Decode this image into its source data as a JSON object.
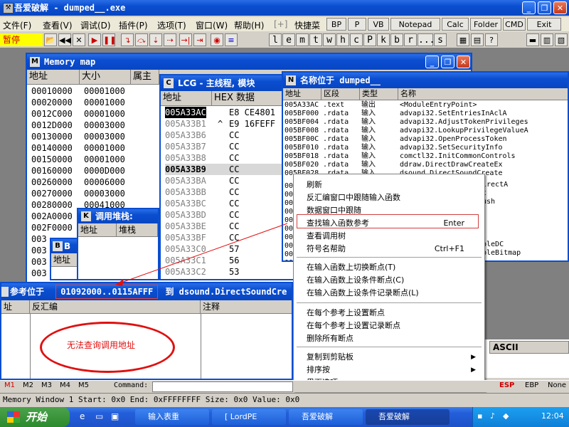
{
  "app": {
    "title": "吾爱破解 - dumped__.exe",
    "title_icon": "tools-icon"
  },
  "menubar": [
    "文件(F)",
    "查看(V)",
    "调试(D)",
    "插件(P)",
    "选项(T)",
    "窗口(W)",
    "帮助(H)",
    "[+]",
    "快捷菜",
    "BP",
    "P",
    "VB",
    "Notepad",
    "Calc",
    "Folder",
    "CMD",
    "Exit"
  ],
  "toolbar": {
    "status": "暂停",
    "letters": [
      "l",
      "e",
      "m",
      "t",
      "w",
      "h",
      "c",
      "P",
      "k",
      "b",
      "r",
      "...",
      "s"
    ]
  },
  "memory_map": {
    "title": "Memory map",
    "headers": [
      "地址",
      "大小",
      "属主"
    ],
    "addresses": [
      "00010000",
      "00020000",
      "0012C000",
      "0012D000",
      "00130000",
      "00140000",
      "00150000",
      "00160000",
      "00260000",
      "00270000",
      "00280000",
      "002A0000",
      "002F0000",
      "003",
      "003",
      "003",
      "003"
    ],
    "sizes": [
      "00001000",
      "00001000",
      "00001000",
      "00003000",
      "00003000",
      "00001000",
      "00001000",
      "0000D000",
      "00006000",
      "00003000",
      "00041000"
    ]
  },
  "lcg_window": {
    "title": "LCG - 主线程, 模块",
    "headers": [
      "地址",
      "HEX 数据"
    ],
    "rows": [
      {
        "addr": "005A33AC",
        "arrow": "",
        "hex": "E8 CE4801"
      },
      {
        "addr": "005A33B1",
        "arrow": "^",
        "hex": "E9 16FEFF"
      },
      {
        "addr": "005A33B6",
        "arrow": "",
        "hex": "CC"
      },
      {
        "addr": "005A33B7",
        "arrow": "",
        "hex": "CC"
      },
      {
        "addr": "005A33B8",
        "arrow": "",
        "hex": "CC"
      },
      {
        "addr": "005A33B9",
        "arrow": "",
        "hex": "CC"
      },
      {
        "addr": "005A33BA",
        "arrow": "",
        "hex": "CC"
      },
      {
        "addr": "005A33BB",
        "arrow": "",
        "hex": "CC"
      },
      {
        "addr": "005A33BC",
        "arrow": "",
        "hex": "CC"
      },
      {
        "addr": "005A33BD",
        "arrow": "",
        "hex": "CC"
      },
      {
        "addr": "005A33BE",
        "arrow": "",
        "hex": "CC"
      },
      {
        "addr": "005A33BF",
        "arrow": "",
        "hex": "CC"
      },
      {
        "addr": "005A33C0",
        "arrow": "",
        "hex": "57"
      },
      {
        "addr": "005A33C1",
        "arrow": "",
        "hex": "56"
      },
      {
        "addr": "005A33C2",
        "arrow": "",
        "hex": "53"
      }
    ]
  },
  "call_stack": {
    "title": "调用堆栈:",
    "headers": [
      "地址",
      "堆栈"
    ]
  },
  "b_window": {
    "title": "B",
    "header": "地址"
  },
  "names_window": {
    "title": "名称位于 dumped__",
    "headers": [
      "地址",
      "区段",
      "类型",
      "名称"
    ],
    "rows": [
      {
        "addr": "005A33AC",
        "sect": ".text",
        "type": "输出",
        "name": "<ModuleEntryPoint>"
      },
      {
        "addr": "005BF000",
        "sect": ".rdata",
        "type": "输入",
        "name": "advapi32.SetEntriesInAclA"
      },
      {
        "addr": "005BF004",
        "sect": ".rdata",
        "type": "输入",
        "name": "advapi32.AdjustTokenPrivileges"
      },
      {
        "addr": "005BF008",
        "sect": ".rdata",
        "type": "输入",
        "name": "advapi32.LookupPrivilegeValueA"
      },
      {
        "addr": "005BF00C",
        "sect": ".rdata",
        "type": "输入",
        "name": "advapi32.OpenProcessToken"
      },
      {
        "addr": "005BF010",
        "sect": ".rdata",
        "type": "输入",
        "name": "advapi32.SetSecurityInfo"
      },
      {
        "addr": "005BF018",
        "sect": ".rdata",
        "type": "输入",
        "name": "comctl32.InitCommonControls"
      },
      {
        "addr": "005BF020",
        "sect": ".rdata",
        "type": "输入",
        "name": "ddraw.DirectDrawCreateEx"
      },
      {
        "addr": "005BF028",
        "sect": ".rdata",
        "type": "输入",
        "name": "dsound.DirectSoundCreate"
      }
    ],
    "partial_left": [
      "00",
      "00",
      "00",
      "00",
      "00",
      "00",
      "00",
      "00",
      "00",
      "00",
      "00",
      "00"
    ],
    "partial_right": {
      "r1": "irectA",
      "r2": "t",
      "r3": "ush",
      "r4": "bleDC",
      "r5": "bleBitmap"
    }
  },
  "context_menu": {
    "items": [
      {
        "label": "刷新",
        "shortcut": ""
      },
      {
        "label": "反汇编窗口中跟随输入函数",
        "shortcut": ""
      },
      {
        "label": "数据窗口中跟随",
        "shortcut": ""
      },
      {
        "label": "查找输入函数参考",
        "shortcut": "Enter"
      },
      {
        "label": "查看调用树",
        "shortcut": ""
      },
      {
        "label": "符号名帮助",
        "shortcut": "Ctrl+F1"
      },
      {
        "label": "在输入函数上切换断点(T)",
        "shortcut": ""
      },
      {
        "label": "在输入函数上设条件断点(C)",
        "shortcut": ""
      },
      {
        "label": "在输入函数上设条件记录断点(L)",
        "shortcut": ""
      },
      {
        "label": "在每个参考上设置断点",
        "shortcut": ""
      },
      {
        "label": "在每个参考上设置记录断点",
        "shortcut": ""
      },
      {
        "label": "删除所有断点",
        "shortcut": ""
      },
      {
        "label": "复制到剪贴板",
        "shortcut": ""
      },
      {
        "label": "排序按",
        "shortcut": ""
      },
      {
        "label": "界面选项",
        "shortcut": ""
      }
    ]
  },
  "refs_window": {
    "title_prefix": "参考位于",
    "title_range": "01092000..0115AFFF",
    "title_suffix": "到 dsound.DirectSoundCre",
    "headers": [
      "址",
      "反汇编",
      "注释"
    ],
    "annotation": "无法查询调用地址"
  },
  "dump_panel": {
    "ascii_header": "ASCII"
  },
  "bottom_bar": {
    "tabs": [
      "M1",
      "M2",
      "M3",
      "M4",
      "M5"
    ],
    "command_label": "Command:",
    "regs": [
      "ESP",
      "EBP",
      "None"
    ]
  },
  "statusbar": {
    "text": "Memory Window 1  Start: 0x0  End: 0xFFFFFFFF  Size: 0x0 Value: 0x0"
  },
  "taskbar": {
    "start": "开始",
    "buttons": [
      "输入表重",
      "[ LordPE",
      "吾爱破解",
      "吾爱破解"
    ],
    "clock": "12:04"
  },
  "colors": {
    "title_blue": "#0a4ed0",
    "highlight": "#000000",
    "status_red": "#cc0000",
    "annotation_red": "#e01010"
  }
}
